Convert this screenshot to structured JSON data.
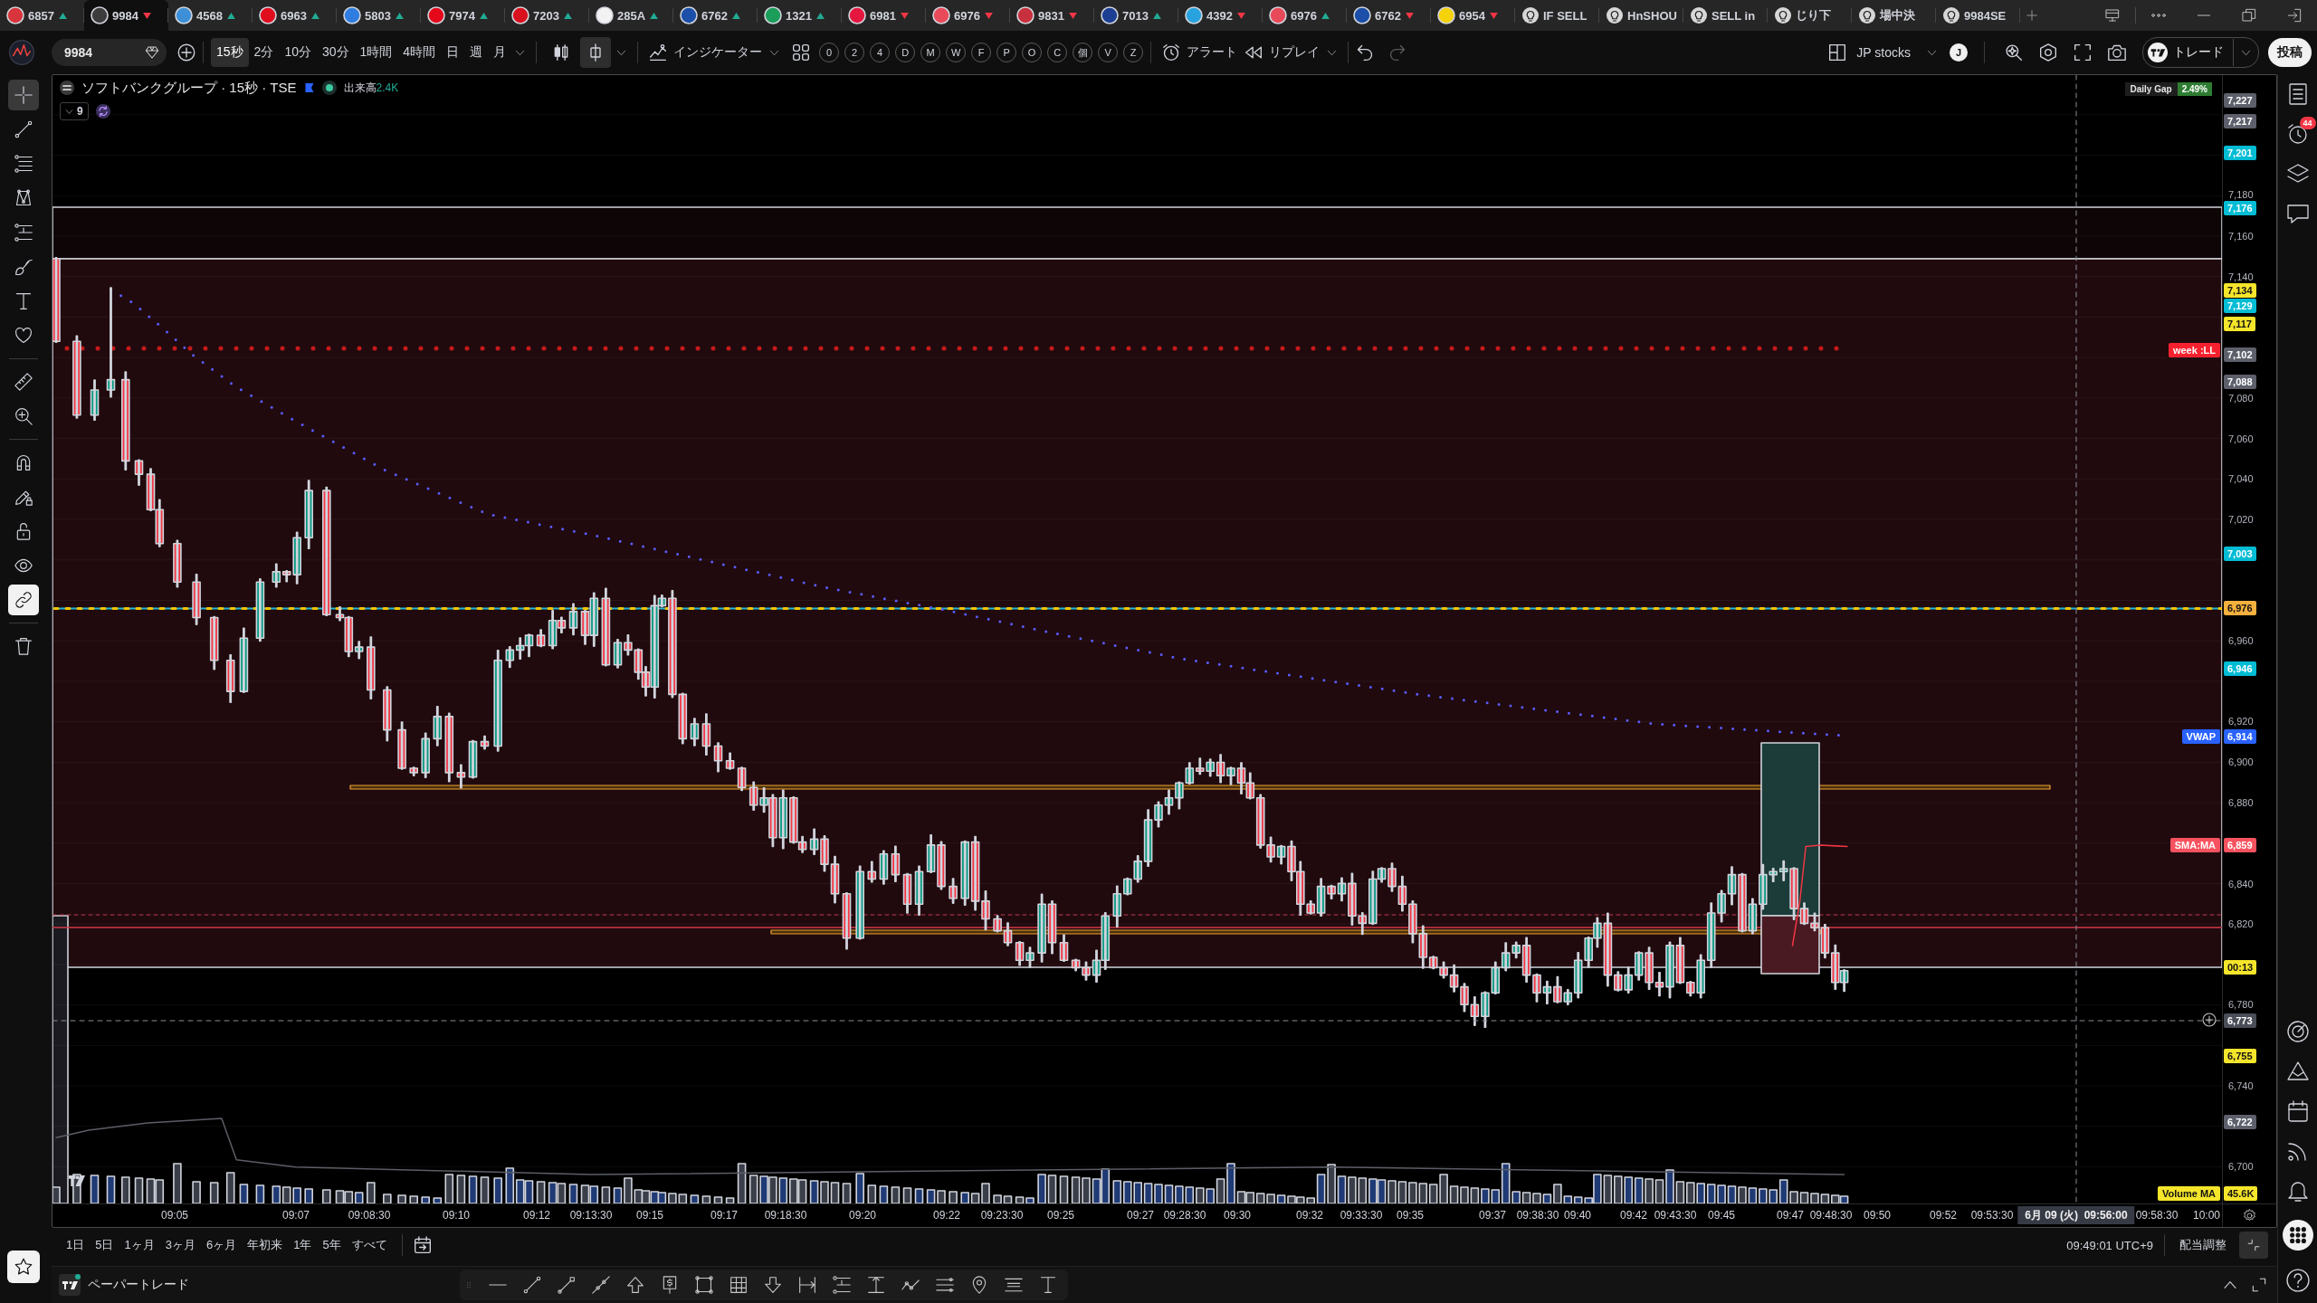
{
  "tabs": [
    {
      "kind": "symbol",
      "label": "6857",
      "rising": true,
      "color": "#d8343c",
      "selected": false
    },
    {
      "kind": "symbol",
      "label": "9984",
      "rising": false,
      "color": "#3c3c3c",
      "selected": true
    },
    {
      "kind": "symbol",
      "label": "4568",
      "rising": true,
      "color": "#3d8fd8",
      "selected": false
    },
    {
      "kind": "symbol",
      "label": "6963",
      "rising": true,
      "color": "#e00d1f",
      "selected": false
    },
    {
      "kind": "symbol",
      "label": "5803",
      "rising": true,
      "color": "#2f7de1",
      "selected": false
    },
    {
      "kind": "symbol",
      "label": "7974",
      "rising": true,
      "color": "#e4081a",
      "selected": false
    },
    {
      "kind": "symbol",
      "label": "7203",
      "rising": true,
      "color": "#d9111f",
      "selected": false
    },
    {
      "kind": "symbol",
      "label": "285A",
      "rising": true,
      "color": "#f2f2f2",
      "selected": false
    },
    {
      "kind": "symbol",
      "label": "6762",
      "rising": true,
      "color": "#1b4fa8",
      "selected": false
    },
    {
      "kind": "symbol",
      "label": "1321",
      "rising": true,
      "color": "#1a9e5a",
      "selected": false
    },
    {
      "kind": "symbol",
      "label": "6981",
      "rising": false,
      "color": "#e5173f",
      "selected": false
    },
    {
      "kind": "symbol",
      "label": "6976",
      "rising": false,
      "color": "#e84a5a",
      "selected": false
    },
    {
      "kind": "symbol",
      "label": "9831",
      "rising": false,
      "color": "#c9303e",
      "selected": false
    },
    {
      "kind": "symbol",
      "label": "7013",
      "rising": true,
      "color": "#1c3f94",
      "selected": false
    },
    {
      "kind": "symbol",
      "label": "4392",
      "rising": false,
      "color": "#29a3e0",
      "selected": false
    },
    {
      "kind": "symbol",
      "label": "6976",
      "rising": true,
      "color": "#e84a5a",
      "selected": false
    },
    {
      "kind": "symbol",
      "label": "6762",
      "rising": false,
      "color": "#1b4fa8",
      "selected": false
    },
    {
      "kind": "symbol",
      "label": "6954",
      "rising": false,
      "color": "#f5d20a",
      "selected": false
    },
    {
      "kind": "alert",
      "label": "IF SELL",
      "selected": false
    },
    {
      "kind": "alert",
      "label": "HnSHOU",
      "selected": false
    },
    {
      "kind": "alert",
      "label": "SELL in",
      "selected": false
    },
    {
      "kind": "alert",
      "label": "じり下",
      "selected": false
    },
    {
      "kind": "alert",
      "label": "場中決",
      "selected": false
    },
    {
      "kind": "alert",
      "label": "9984SE",
      "selected": false
    }
  ],
  "toolbar": {
    "symbol": "9984",
    "intervals": [
      {
        "label": "15秒",
        "selected": true
      },
      {
        "label": "2分",
        "selected": false
      },
      {
        "label": "10分",
        "selected": false
      },
      {
        "label": "30分",
        "selected": false
      },
      {
        "label": "1時間",
        "selected": false
      },
      {
        "label": "4時間",
        "selected": false
      },
      {
        "label": "日",
        "selected": false
      },
      {
        "label": "週",
        "selected": false
      },
      {
        "label": "月",
        "selected": false
      }
    ],
    "chart_styles": [
      {
        "selected": false
      },
      {
        "selected": true
      }
    ],
    "indicators": "インジケーター",
    "quick_buttons": [
      "0",
      "2",
      "4",
      "D",
      "M",
      "W",
      "F",
      "P",
      "O",
      "C",
      "個",
      "V",
      "Z"
    ],
    "alert": "アラート",
    "replay": "リプレイ",
    "layout": "JP stocks",
    "user_initial": "J",
    "trade": "トレード",
    "publish": "投稿"
  },
  "drawing_tools": [
    {
      "selected": true
    },
    {
      "selected": false
    },
    {
      "selected": false
    },
    {
      "selected": false
    },
    {
      "selected": false
    },
    {
      "selected": false
    },
    {
      "selected": false
    },
    {
      "selected": false
    },
    {
      "selected": false
    },
    {
      "selected": false
    }
  ],
  "drawing_toggles": [
    {
      "on": false
    },
    {
      "on": false
    },
    {
      "on": false
    },
    {
      "on": false
    },
    {
      "on": true
    }
  ],
  "legend": {
    "title": "ソフトバンクグループ · 15秒 · TSE",
    "volume_label": "出来高",
    "volume_value": "2.4K",
    "indicator_count": "9"
  },
  "chart": {
    "daily_gap_label": "Daily Gap",
    "daily_gap_value": "2.49%",
    "line_captions": [
      {
        "text": "week :LL",
        "color": "#f7212e"
      },
      {
        "text": "VWAP",
        "color": "#2962ff"
      },
      {
        "text": "SMA:MA",
        "color": "#f7525f"
      },
      {
        "text": "Volume MA",
        "color": "#f5e52b"
      }
    ]
  },
  "price_axis": [
    {
      "text": "7,227",
      "kind": "badge",
      "color": "#5d606b"
    },
    {
      "text": "7,217",
      "kind": "badge",
      "color": "#5d606b"
    },
    {
      "text": "7,201",
      "kind": "badge",
      "color": "#00bcd4"
    },
    {
      "text": "7,180",
      "kind": "tick"
    },
    {
      "text": "7,176",
      "kind": "badge",
      "color": "#00bcd4"
    },
    {
      "text": "7,160",
      "kind": "tick"
    },
    {
      "text": "7,140",
      "kind": "tick"
    },
    {
      "text": "7,134",
      "kind": "badge",
      "color": "#f5e52b"
    },
    {
      "text": "7,129",
      "kind": "badge",
      "color": "#00bcd4"
    },
    {
      "text": "7,117",
      "kind": "badge",
      "color": "#f5e52b"
    },
    {
      "text": "7,102",
      "kind": "badge",
      "color": "#5d606b"
    },
    {
      "text": "7,088",
      "kind": "badge",
      "color": "#5d606b"
    },
    {
      "text": "7,080",
      "kind": "tick"
    },
    {
      "text": "7,060",
      "kind": "tick"
    },
    {
      "text": "7,040",
      "kind": "tick"
    },
    {
      "text": "7,020",
      "kind": "tick"
    },
    {
      "text": "7,003",
      "kind": "badge",
      "color": "#00bcd4"
    },
    {
      "text": "6,976",
      "kind": "badge",
      "color": "#f5b13d"
    },
    {
      "text": "6,960",
      "kind": "tick"
    },
    {
      "text": "6,946",
      "kind": "badge",
      "color": "#00bcd4"
    },
    {
      "text": "6,920",
      "kind": "tick"
    },
    {
      "text": "6,914",
      "kind": "badge",
      "color": "#2962ff"
    },
    {
      "text": "6,900",
      "kind": "tick"
    },
    {
      "text": "6,880",
      "kind": "tick"
    },
    {
      "text": "6,859",
      "kind": "badge",
      "color": "#f7525f"
    },
    {
      "text": "6,840",
      "kind": "tick"
    },
    {
      "text": "6,820",
      "kind": "tick"
    },
    {
      "text": "00:13",
      "kind": "badge",
      "color": "#f5e52b"
    },
    {
      "text": "6,780",
      "kind": "tick"
    },
    {
      "text": "6,773",
      "kind": "cursor",
      "color": "#4a4e58"
    },
    {
      "text": "6,755",
      "kind": "badge",
      "color": "#f5e52b"
    },
    {
      "text": "6,740",
      "kind": "tick"
    },
    {
      "text": "6,722",
      "kind": "badge",
      "color": "#5d606b"
    },
    {
      "text": "6,700",
      "kind": "tick"
    },
    {
      "text": "45.6K",
      "kind": "badge",
      "color": "#f5e52b"
    }
  ],
  "time_axis": {
    "labels": [
      "09:05",
      "09:07",
      "09:08:30",
      "09:10",
      "09:12",
      "09:13:30",
      "09:15",
      "09:17",
      "09:18:30",
      "09:20",
      "09:22",
      "09:23:30",
      "09:25",
      "09:27",
      "09:28:30",
      "09:30",
      "09:32",
      "09:33:30",
      "09:35",
      "09:37",
      "09:38:30",
      "09:40",
      "09:42",
      "09:43:30",
      "09:45",
      "09:47",
      "09:48:30",
      "09:50",
      "09:52",
      "09:53:30",
      "09:58:30",
      "10:00"
    ],
    "cursor_label": "6月 09 (火)  09:56:00"
  },
  "range_bar": {
    "ranges": [
      "1日",
      "5日",
      "1ヶ月",
      "3ヶ月",
      "6ヶ月",
      "年初来",
      "1年",
      "5年",
      "すべて"
    ],
    "clock": "09:49:01 UTC+9",
    "adjustment": "配当調整"
  },
  "bottom_bar": {
    "label": "ペーパートレード"
  },
  "sidebar": {
    "alert_count": "44"
  }
}
